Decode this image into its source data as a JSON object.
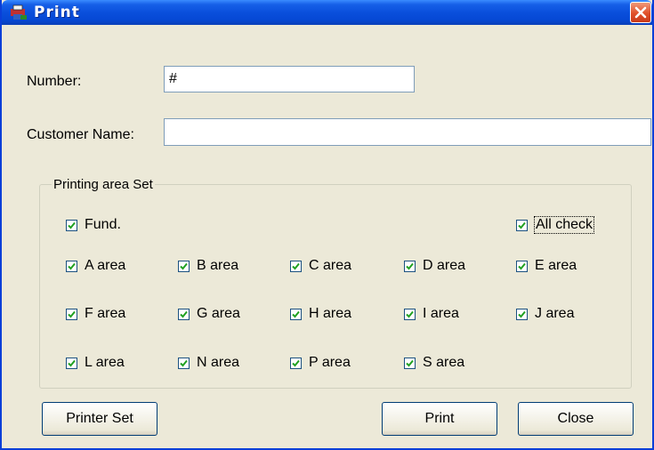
{
  "window": {
    "title": "Print"
  },
  "form": {
    "number_label": "Number:",
    "number_value": "#",
    "customer_label": "Customer Name:",
    "customer_value": ""
  },
  "group": {
    "legend": "Printing area Set",
    "fund": {
      "label": "Fund.",
      "checked": true
    },
    "all_check": {
      "label": "All check",
      "checked": true
    },
    "areas": [
      {
        "label": "A area",
        "checked": true
      },
      {
        "label": "B area",
        "checked": true
      },
      {
        "label": "C area",
        "checked": true
      },
      {
        "label": "D area",
        "checked": true
      },
      {
        "label": "E area",
        "checked": true
      },
      {
        "label": "F area",
        "checked": true
      },
      {
        "label": "G area",
        "checked": true
      },
      {
        "label": "H area",
        "checked": true
      },
      {
        "label": "I area",
        "checked": true
      },
      {
        "label": "J area",
        "checked": true
      },
      {
        "label": "L area",
        "checked": true
      },
      {
        "label": "N area",
        "checked": true
      },
      {
        "label": "P area",
        "checked": true
      },
      {
        "label": "S area",
        "checked": true
      }
    ]
  },
  "buttons": {
    "printer_set": "Printer Set",
    "print": "Print",
    "close": "Close"
  },
  "icons": {
    "app": "printer-app-icon",
    "close": "close-icon",
    "check": "checkmark-icon"
  },
  "colors": {
    "titlebar": "#0a4fdc",
    "close_button": "#e0502a",
    "dialog_bg": "#ece9d8"
  }
}
